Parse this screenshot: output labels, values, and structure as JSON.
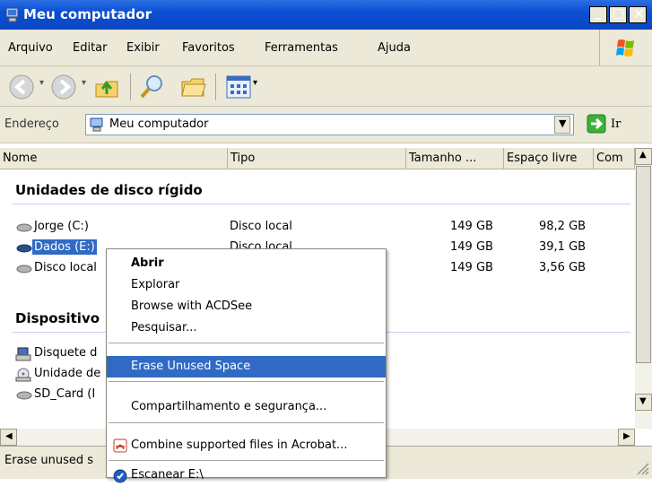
{
  "window": {
    "title": "Meu computador",
    "minimize_label": "_",
    "maximize_label": "□",
    "close_label": "×"
  },
  "menu": [
    "Arquivo",
    "Editar",
    "Exibir",
    "Favoritos",
    "Ferramentas",
    "Ajuda"
  ],
  "toolbar": {
    "icons": [
      "back-icon",
      "forward-icon",
      "up-folder-icon",
      "search-icon",
      "folders-icon",
      "views-icon"
    ]
  },
  "address": {
    "label": "Endereço",
    "value": "Meu computador",
    "go_label": "Ir"
  },
  "columns": [
    "Nome",
    "Tipo",
    "Tamanho ...",
    "Espaço livre",
    "Com"
  ],
  "groups": {
    "hard_disks": "Unidades de disco rígido",
    "removable": "Dispositivo"
  },
  "drives": [
    {
      "name": "Jorge (C:)",
      "type": "Disco local",
      "size": "149 GB",
      "free": "98,2 GB"
    },
    {
      "name": "Dados (E:)",
      "type": "Disco local",
      "size": "149 GB",
      "free": "39,1 GB"
    },
    {
      "name": "Disco local",
      "type": "",
      "size": "149 GB",
      "free": "3,56 GB"
    }
  ],
  "devices": [
    "Disquete d",
    "Unidade de",
    "SD_Card (I"
  ],
  "status": "Erase unused s",
  "context_menu": {
    "items": [
      "Abrir",
      "Explorar",
      "Browse with ACDSee",
      "Pesquisar...",
      "Erase Unused Space",
      "Compartilhamento e segurança...",
      "Combine supported files in Acrobat...",
      "Escanear E:\\"
    ]
  },
  "colors": {
    "titlebar": "#0a4fd3",
    "selection": "#316ac5",
    "chrome": "#ece9d8"
  }
}
